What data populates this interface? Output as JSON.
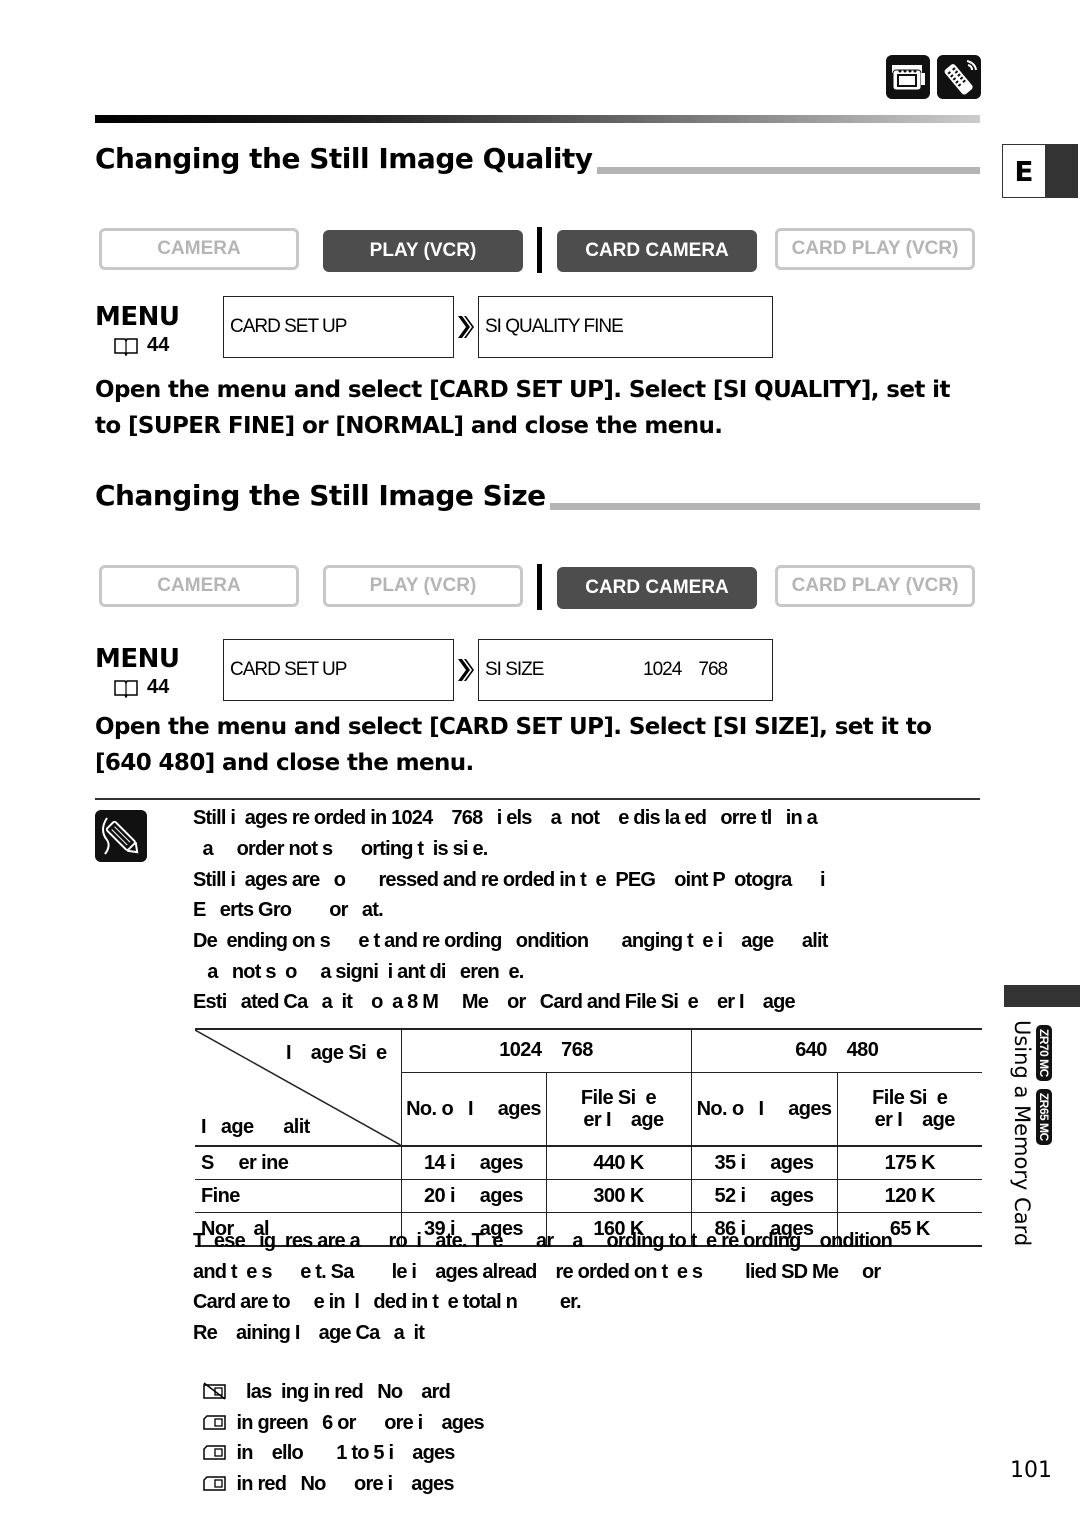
{
  "header": {
    "icons": [
      "camcorder-icon",
      "remote-control-icon"
    ],
    "language_tab": "E"
  },
  "sections": [
    {
      "title": "Changing the Still Image Quality",
      "modes": [
        {
          "label": "CAMERA",
          "active": false
        },
        {
          "label": "PLAY (VCR)",
          "active": true
        },
        {
          "label": "CARD CAMERA",
          "active": true
        },
        {
          "label": "CARD PLAY (VCR)",
          "active": false
        }
      ],
      "menu": {
        "label": "MENU",
        "page_ref": "44",
        "step1": "CARD SET UP",
        "step2": "SI QUALITY  FINE"
      },
      "instruction": "Open the menu and select [CARD SET UP]. Select [SI QUALITY], set it to [SUPER FINE] or [NORMAL] and close the menu."
    },
    {
      "title": "Changing the Still Image Size",
      "modes": [
        {
          "label": "CAMERA",
          "active": false
        },
        {
          "label": "PLAY (VCR)",
          "active": false
        },
        {
          "label": "CARD CAMERA",
          "active": true
        },
        {
          "label": "CARD PLAY (VCR)",
          "active": false
        }
      ],
      "menu": {
        "label": "MENU",
        "page_ref": "44",
        "step1": "CARD SET UP",
        "step2_label": "SI SIZE",
        "step2_value": "1024    768"
      },
      "instruction": "Open the menu and select [CARD SET UP]. Select [SI SIZE], set it to [640 480] and close the menu."
    }
  ],
  "notes": {
    "lines": [
      "Still i  ages re orded in 1024    768   i els    a  not    e dis la ed   orre tl   in a",
      "  a     order not s      orting t  is si e.",
      "Still i  ages are   o       ressed and re orded in t  e  PEG    oint P  otogra      i",
      "E   erts Gro        or   at.",
      "De  ending on s      e t and re ording   ondition       anging t  e i    age      alit",
      "   a   not s  o     a signi  i ant di   eren  e.",
      "Esti   ated Ca   a  it    o  a 8 M     Me    or   Card and File Si  e    er I    age"
    ]
  },
  "table": {
    "corner_top": "I    age Si  e",
    "corner_bottom": "I   age      alit",
    "sizes": [
      "1024    768",
      "640    480"
    ],
    "sub_headers": [
      "No. o   I     ages",
      "File Si  e\n  er I    age",
      "No. o   I     ages",
      "File Si  e\n  er I    age"
    ],
    "rows": [
      {
        "quality": "S     er ine",
        "cells": [
          "14 i     ages",
          "440 K",
          "35 i     ages",
          "175 K"
        ]
      },
      {
        "quality": "Fine",
        "cells": [
          "20 i     ages",
          "300 K",
          "52 i     ages",
          "120 K"
        ]
      },
      {
        "quality": "Nor    al",
        "cells": [
          "39 i     ages",
          "160 K",
          "86 i     ages",
          "65 K"
        ]
      }
    ]
  },
  "footer_notes": {
    "lines": [
      "T  ese   ig  res are a      ro  i   ate. T  e       ar    a     ording to t  e re ording    ondition",
      "and t  e s      e t. Sa        le i    ages alread    re orded on t  e s         lied SD Me     or",
      "Card are to     e in  l   ded in t  e total n         er.",
      "Re    aining I    age Ca   a  it"
    ],
    "indicators": [
      {
        "icon": "no-card-icon",
        "text": "  las  ing in red   No    ard"
      },
      {
        "icon": "card-icon",
        "text": "in green   6 or      ore i    ages"
      },
      {
        "icon": "card-icon",
        "text": "in    ello       1 to 5 i    ages"
      },
      {
        "icon": "card-icon",
        "text": "in red   No      ore i    ages"
      }
    ]
  },
  "side_tab": {
    "label": "Using a Memory Card",
    "models": [
      "ZR70 MC",
      "ZR65 MC"
    ]
  },
  "page_number": "101"
}
